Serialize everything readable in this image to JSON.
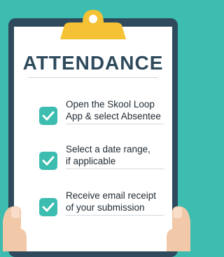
{
  "title": "ATTENDANCE",
  "steps": [
    {
      "line1": "Open the Skool Loop",
      "line2": "App & select Absentee",
      "checked": true
    },
    {
      "line1": "Select a date range,",
      "line2": "if applicable",
      "checked": true
    },
    {
      "line1": "Receive email receipt",
      "line2": "of your submission",
      "checked": true
    }
  ],
  "colors": {
    "background": "#3dbcb0",
    "board": "#2e4a5c",
    "clip": "#f5c235",
    "checkbox": "#3dbcb0",
    "title": "#2e4a5c"
  },
  "icons": [
    "clipboard-clip-icon",
    "checkmark-icon",
    "hand-icon"
  ]
}
